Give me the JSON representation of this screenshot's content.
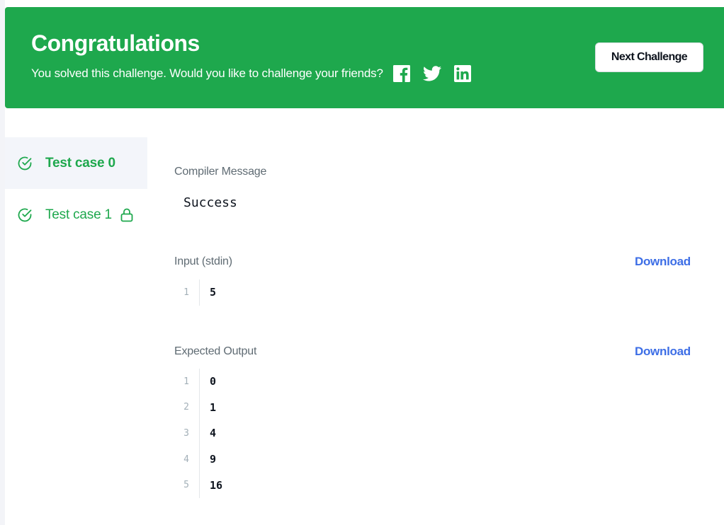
{
  "banner": {
    "title": "Congratulations",
    "subtitle": "You solved this challenge. Would you like to challenge your friends?",
    "share_icons": [
      "facebook-icon",
      "twitter-icon",
      "linkedin-icon"
    ],
    "next_button_label": "Next Challenge",
    "background_color": "#1ea84d"
  },
  "sidebar": {
    "tabs": [
      {
        "label": "Test case 0",
        "status": "passed",
        "active": true,
        "locked": false
      },
      {
        "label": "Test case 1",
        "status": "passed",
        "active": false,
        "locked": true
      }
    ]
  },
  "main": {
    "compiler": {
      "label": "Compiler Message",
      "message": "Success"
    },
    "input": {
      "label": "Input (stdin)",
      "download_label": "Download",
      "lines": [
        {
          "no": "1",
          "value": "5"
        }
      ]
    },
    "expected_output": {
      "label": "Expected Output",
      "download_label": "Download",
      "lines": [
        {
          "no": "1",
          "value": "0"
        },
        {
          "no": "2",
          "value": "1"
        },
        {
          "no": "3",
          "value": "4"
        },
        {
          "no": "4",
          "value": "9"
        },
        {
          "no": "5",
          "value": "16"
        }
      ]
    }
  },
  "colors": {
    "accent_green": "#1ea84d",
    "link_blue": "#3d6ee6",
    "muted_text": "#5f6b73"
  }
}
